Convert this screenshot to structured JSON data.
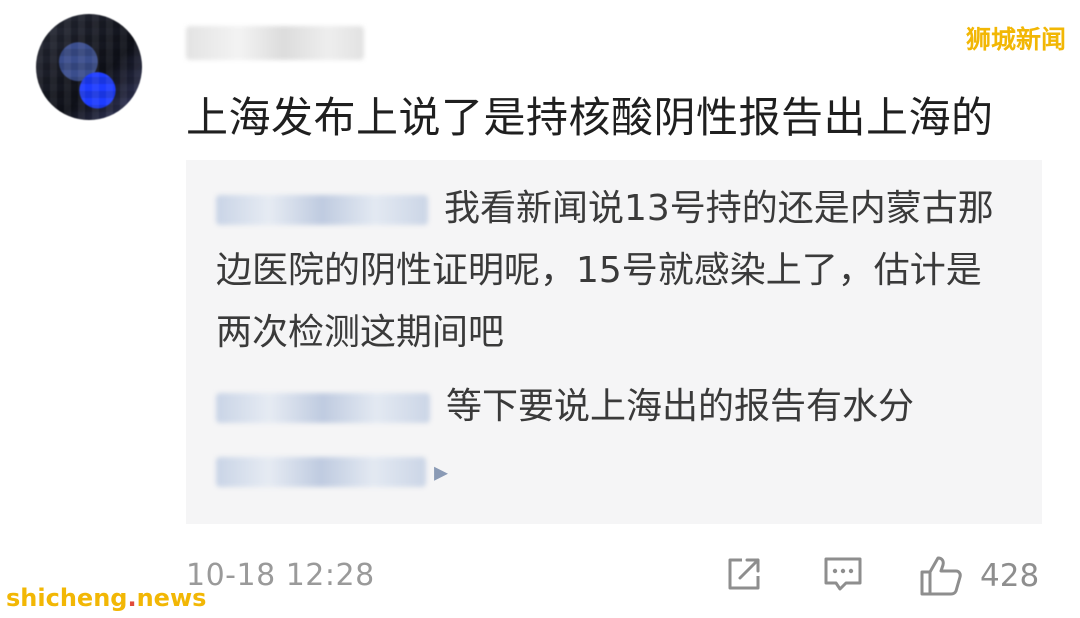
{
  "watermarks": {
    "top_right": "狮城新闻",
    "bottom_left_prefix": "shicheng",
    "bottom_left_dot": ".",
    "bottom_left_suffix": "news"
  },
  "comment": {
    "text": "上海发布上说了是持核酸阴性报告出上海的",
    "timestamp": "10-18 12:28",
    "like_count": "428"
  },
  "replies": [
    {
      "text": "我看新闻说13号持的还是内蒙古那边医院的阴性证明呢，15号就感染上了，估计是两次检测这期间吧"
    },
    {
      "text": "等下要说上海出的报告有水分"
    },
    {
      "text": ""
    }
  ],
  "icons": {
    "share": "share-icon",
    "comment": "comment-icon",
    "like": "thumbs-up-icon",
    "more": "chevron-right-icon"
  },
  "colors": {
    "watermark": "#f2b705",
    "reply_box": "#f5f5f6",
    "meta_text": "#9a9a9a"
  }
}
